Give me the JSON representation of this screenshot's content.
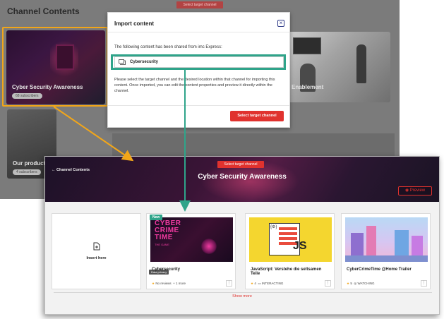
{
  "background_screen": {
    "title": "Channel Contents",
    "select_target_button": "Select target channel",
    "cards": [
      {
        "label": "Cyber Security Awareness",
        "badge": "68 subscribers"
      },
      {
        "label": "Our product",
        "badge": "4 subscribers"
      },
      {
        "label": "Enablement"
      }
    ]
  },
  "dialog": {
    "title": "Import content",
    "close_icon": "close-icon",
    "intro": "The following content has been shared from imc Express:",
    "item": {
      "icon": "course-icon",
      "label": "Cybersecurity"
    },
    "description": "Please select the target channel and the desired location within that channel for importing this content. Once imported, you can edit the content properties and preview it directly within the channel.",
    "primary_button": "Select target channel"
  },
  "channel_page": {
    "back_link": "← Channel Contents",
    "select_target_button": "Select target channel",
    "title": "Cyber Security Awareness",
    "preview_button": "Preview",
    "insert_label": "Insert here",
    "tiles": [
      {
        "badge": "New",
        "thumb_title": "CYBER CRIME TIME",
        "thumb_sub": "THE GAME",
        "overlay": "Data privacy",
        "title": "Cybersecurity",
        "reviews": "No reviews",
        "extra": "+ 1 more"
      },
      {
        "thumb_text": "JS",
        "title": "JavaScript: Verstehe die seltsamen Teile",
        "rating": "4",
        "status": "INTERACTING"
      },
      {
        "title": "CyberCrimeTime @Home Trailer",
        "rating": "5",
        "status": "WATCHING"
      }
    ],
    "show_more": "Show more"
  },
  "colors": {
    "accent_red": "#e0322e",
    "highlight_orange": "#f2a619",
    "highlight_teal": "#2fa48a"
  }
}
